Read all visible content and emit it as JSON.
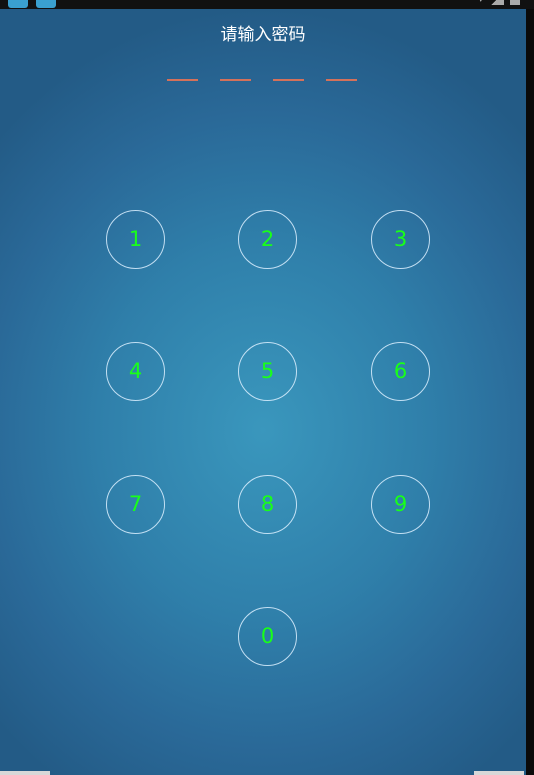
{
  "status_bar": {
    "left_icons": [
      "app-icon",
      "app-icon"
    ],
    "right_icons": [
      "wifi-icon",
      "signal-icon",
      "battery-icon"
    ]
  },
  "lock_screen": {
    "title": "请输入密码",
    "pin_length": 4,
    "entered_digits": 0,
    "dash_color": "#d4715a",
    "digit_color": "#19ff19",
    "keys": [
      "1",
      "2",
      "3",
      "4",
      "5",
      "6",
      "7",
      "8",
      "9",
      "0"
    ]
  }
}
